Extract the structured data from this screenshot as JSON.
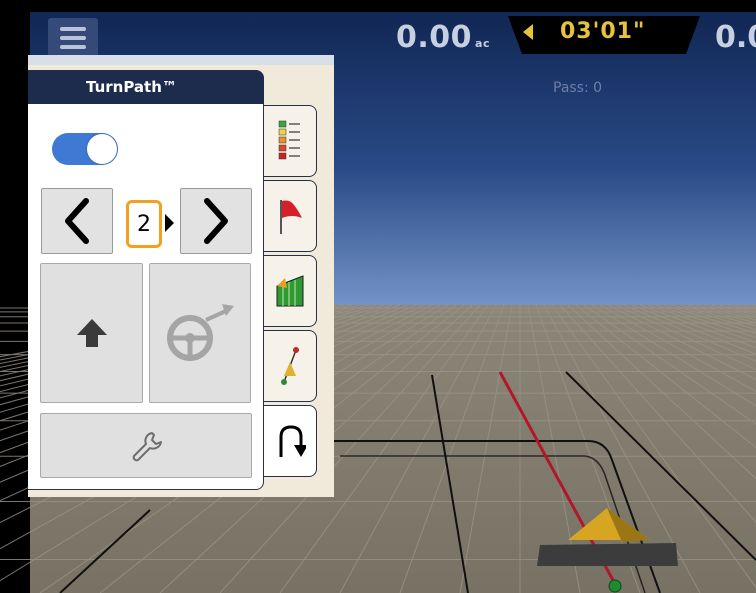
{
  "top_bar": {
    "menu_icon": "hamburger-menu-icon",
    "area_value": "0.00",
    "area_unit": "ac",
    "timer_value": "03'01\"",
    "timer_arrow_icon": "arrow-left-icon",
    "right_value": "0.0",
    "pass_label": "Pass: 0"
  },
  "panel": {
    "title": "TurnPath™",
    "toggle_on": true,
    "pass_number": "2",
    "icons": {
      "prev": "chevron-left-icon",
      "next": "chevron-right-icon",
      "up": "arrow-up-icon",
      "steer": "steering-wheel-engage-icon",
      "settings": "wrench-icon"
    }
  },
  "side_tabs": [
    {
      "icon": "color-legend-icon",
      "active": false
    },
    {
      "icon": "red-flag-icon",
      "active": false
    },
    {
      "icon": "field-coverage-icon",
      "active": false
    },
    {
      "icon": "ab-line-icon",
      "active": false
    },
    {
      "icon": "u-turn-icon",
      "active": true
    }
  ],
  "colors": {
    "sky_top": "#102550",
    "sky_bottom": "#6a8cc3",
    "ground": "#7f7a6c",
    "panel_header": "#1d2b4c",
    "toggle": "#3f79d4",
    "pass_box_border": "#f2a01e",
    "timer_text": "#e7c23c",
    "guidance_line": "#b3162a"
  }
}
